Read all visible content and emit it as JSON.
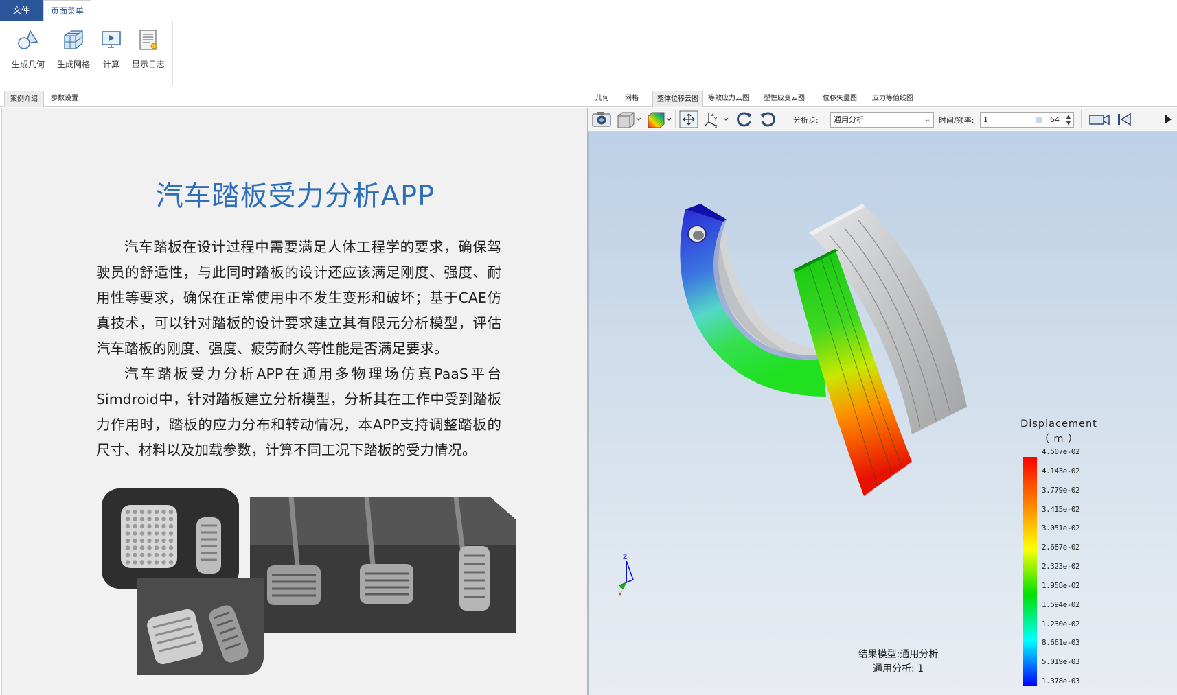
{
  "menu": {
    "file": "文件",
    "page_menu": "页面菜单"
  },
  "ribbon": {
    "buttons": [
      {
        "label": "生成几何",
        "icon": "geometry-icon"
      },
      {
        "label": "生成网格",
        "icon": "mesh-icon"
      },
      {
        "label": "计算",
        "icon": "compute-icon"
      },
      {
        "label": "显示日志",
        "icon": "log-icon"
      }
    ]
  },
  "left_tabs": {
    "intro": "案例介绍",
    "params": "参数设置"
  },
  "intro": {
    "title": "汽车踏板受力分析APP",
    "paragraphs": [
      "汽车踏板在设计过程中需要满足人体工程学的要求，确保驾驶员的舒适性，与此同时踏板的设计还应该满足刚度、强度、耐用性等要求，确保在正常使用中不发生变形和破坏；基于CAE仿真技术，可以针对踏板的设计要求建立其有限元分析模型，评估汽车踏板的刚度、强度、疲劳耐久等性能是否满足要求。",
      "汽车踏板受力分析APP在通用多物理场仿真PaaS平台Simdroid中，针对踏板建立分析模型，分析其在工作中受到踏板力作用时，踏板的应力分布和转动情况，本APP支持调整踏板的尺寸、材料以及加载参数，计算不同工况下踏板的受力情况。"
    ]
  },
  "right_tabs": [
    {
      "label": "几何",
      "active": false
    },
    {
      "label": "网格",
      "active": false
    },
    {
      "label": "整体位移云图",
      "active": true
    },
    {
      "label": "等效应力云图",
      "active": false
    },
    {
      "label": "塑性应变云图",
      "active": false
    },
    {
      "label": "位移矢量图",
      "active": false
    },
    {
      "label": "应力等值线图",
      "active": false
    }
  ],
  "toolbar": {
    "step_label": "分析步:",
    "step_value": "通用分析",
    "time_label": "时间/频率:",
    "time_value": "1",
    "frames_value": "64"
  },
  "legend": {
    "title": "Displacement",
    "unit": "（ m ）",
    "ticks": [
      "4.507e-02",
      "4.143e-02",
      "3.779e-02",
      "3.415e-02",
      "3.051e-02",
      "2.687e-02",
      "2.323e-02",
      "1.958e-02",
      "1.594e-02",
      "1.230e-02",
      "8.661e-03",
      "5.019e-03",
      "1.378e-03"
    ],
    "colors": [
      "#ff0000",
      "#ff8000",
      "#ffff00",
      "#00e000",
      "#00ffff",
      "#0000ff"
    ]
  },
  "result": {
    "model_line": "结果模型:通用分析",
    "step_line": "通用分析: 1"
  },
  "triad": {
    "z": "Z",
    "x": "X"
  }
}
